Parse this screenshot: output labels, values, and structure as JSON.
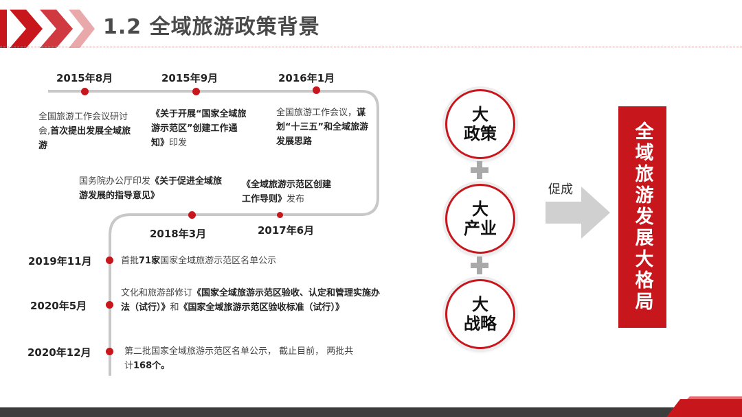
{
  "header": {
    "title": "1.2 全域旅游政策背景"
  },
  "timeline": {
    "e1": {
      "date": "2015年8月",
      "t1": "全国旅游工作会议研讨会,",
      "t2": "首次提出发展全域旅游"
    },
    "e2": {
      "date": "2015年9月",
      "t1": "《关于开展“国家全域旅游示范区”创建工作通知》",
      "t2": "印发"
    },
    "e3": {
      "date": "2016年1月",
      "t1": "全国旅游工作会议，",
      "t2": "谋划“十三五”和全域旅游发展思路"
    },
    "e4": {
      "date": "2018年3月",
      "t1": "国务院办公厅印发",
      "t2": "《关于促进全域旅游发展的指导意见》"
    },
    "e5": {
      "date": "2017年6月",
      "t1": "《全域旅游示范区创建工作导则》",
      "t2": "发布"
    },
    "e6": {
      "date": "2019年11月",
      "t1": "首批",
      "t2": "71家",
      "t3": "国家全域旅游示范区名单公示"
    },
    "e7": {
      "date": "2020年5月",
      "t1": "文化和旅游部修订",
      "t2": "《国家全域旅游示范区验收、认定和管理实施办法（试行）》",
      "t3": "和",
      "t4": "《国家全域旅游示范区验收标准（试行）》"
    },
    "e8": {
      "date": "2020年12月",
      "t1": "第二批国家全域旅游示范区名单公示，  截止目前，  两批共计",
      "t2": "168个。"
    }
  },
  "pillars": [
    {
      "l1": "大",
      "l2": "政策"
    },
    {
      "l1": "大",
      "l2": "产业"
    },
    {
      "l1": "大",
      "l2": "战略"
    }
  ],
  "arrow_label": "促成",
  "result": "全域旅游发展大格局",
  "colors": {
    "accent": "#c8161d",
    "line": "#c8c8c8",
    "arrow": "#d0d0d0"
  }
}
